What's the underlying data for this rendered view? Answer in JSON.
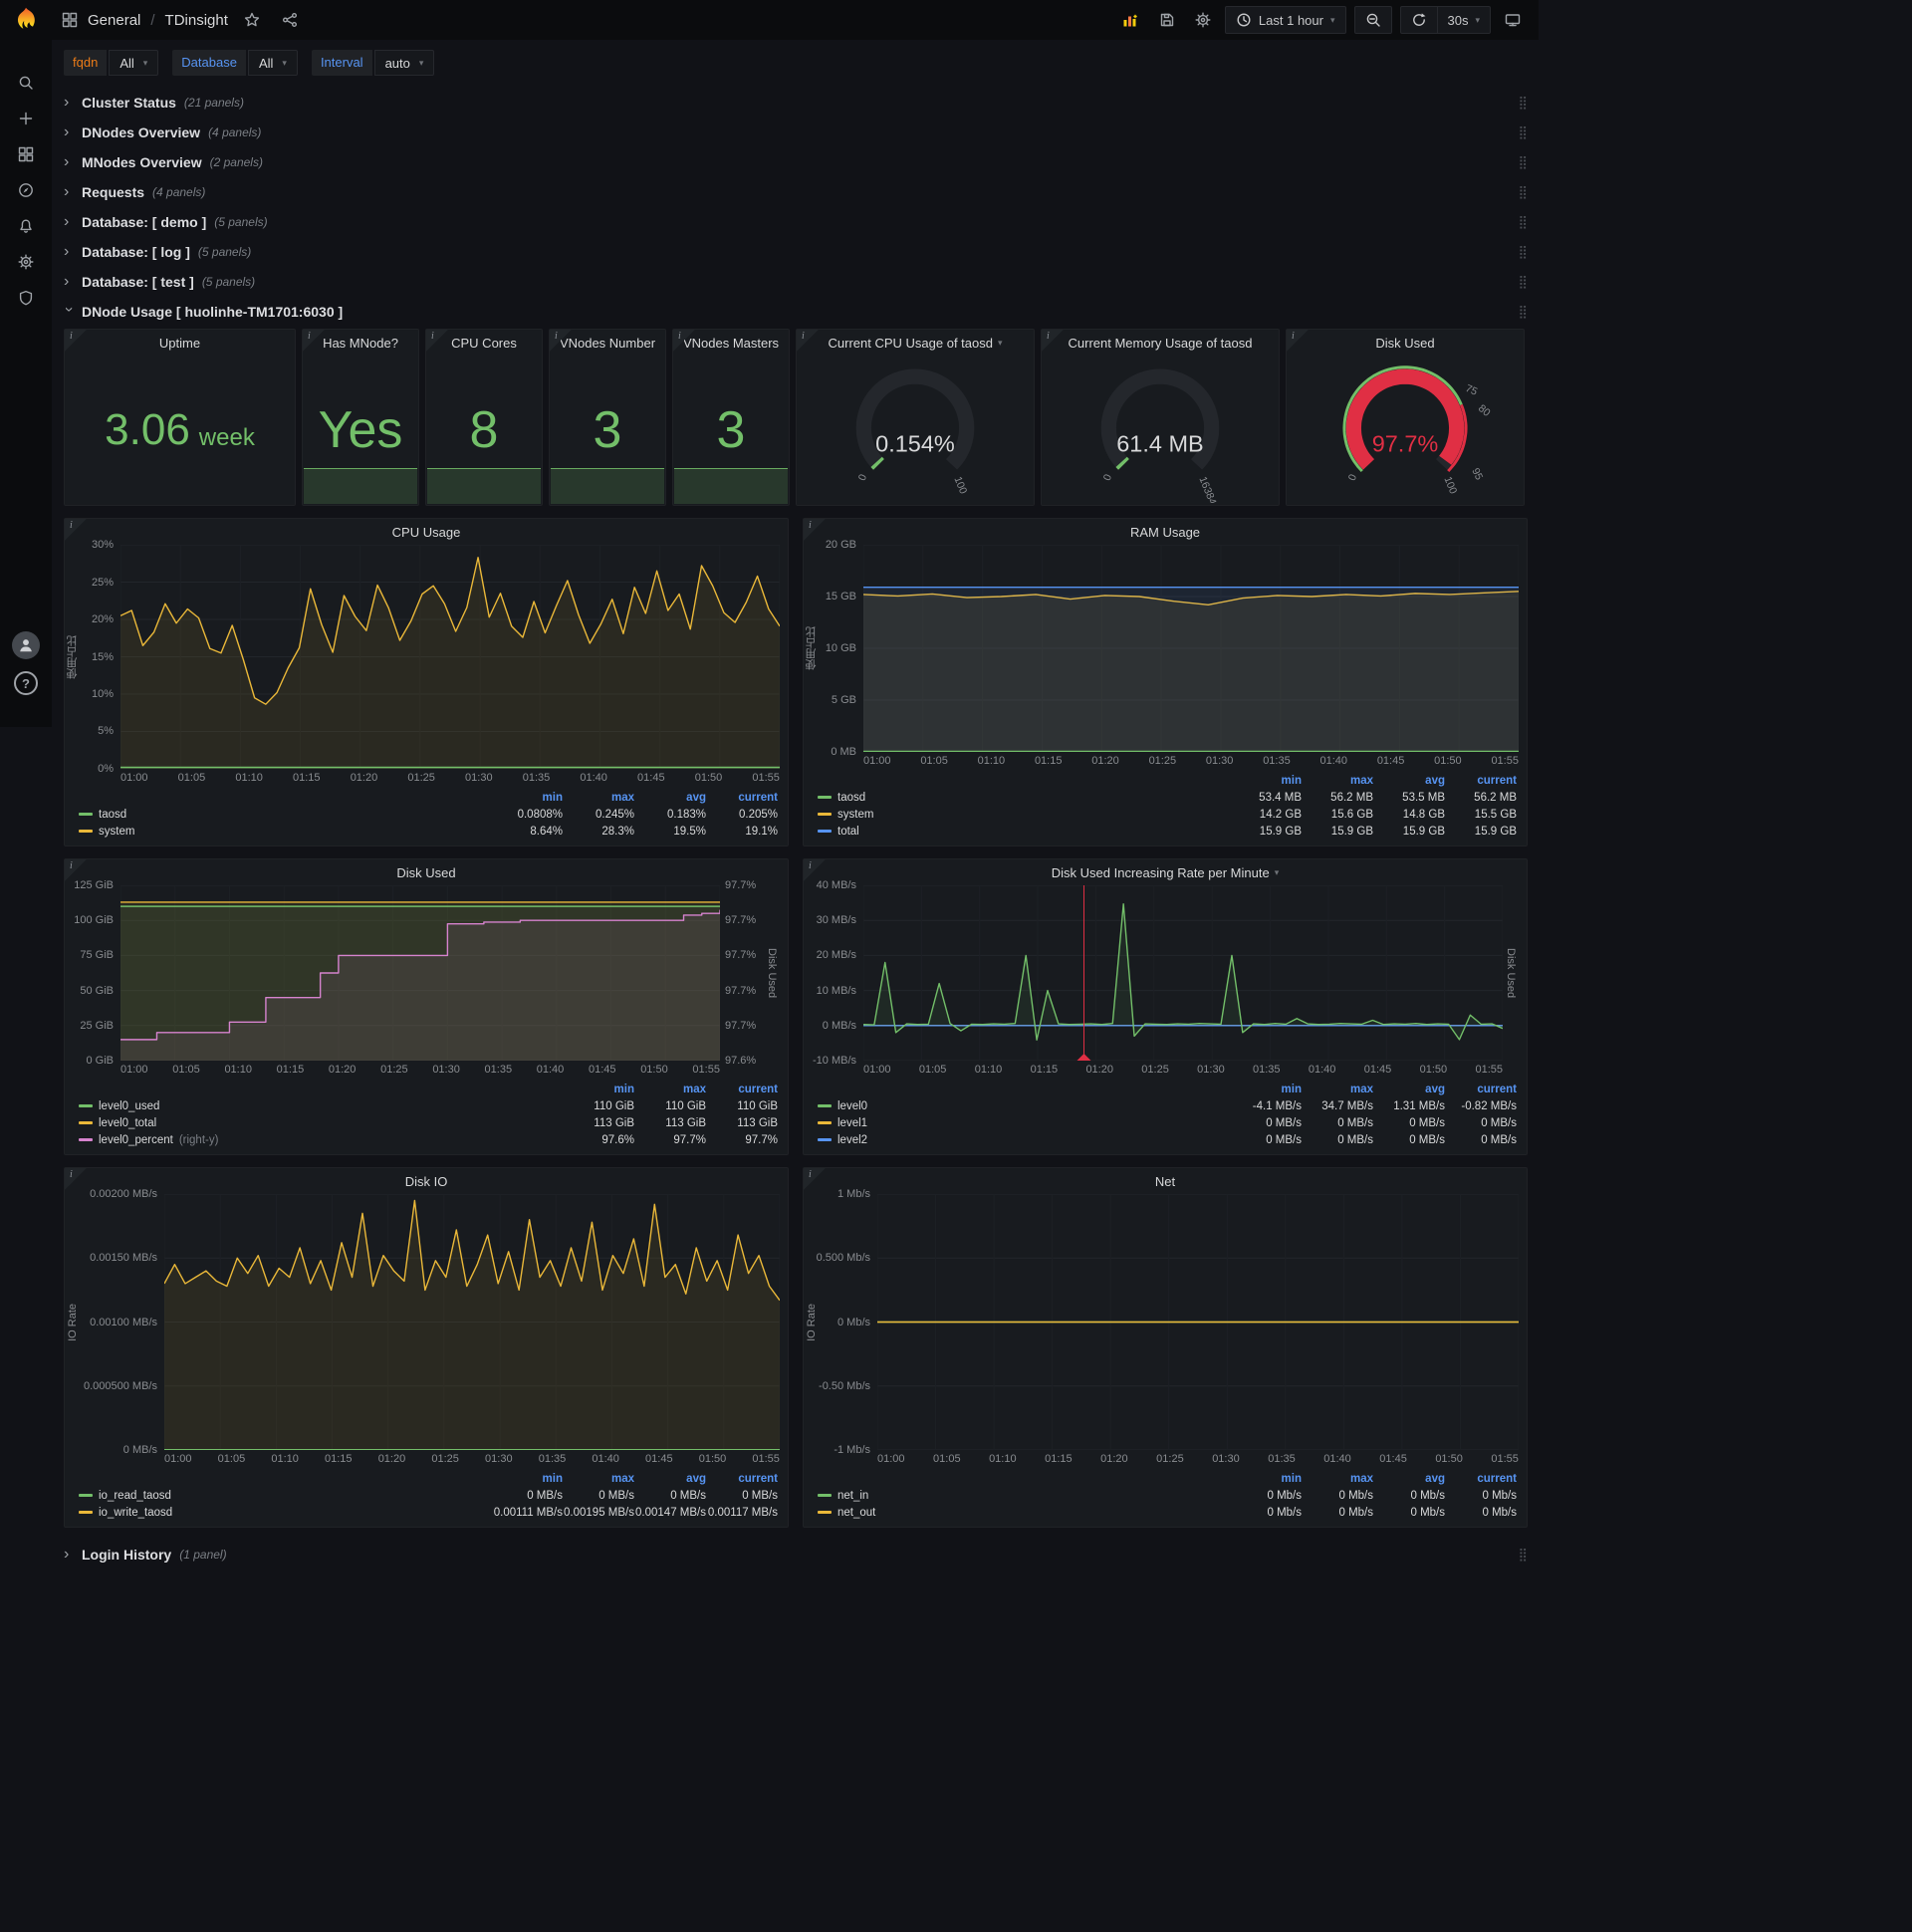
{
  "nav": {
    "breadcrumb": {
      "section": "General",
      "divider": "/",
      "page": "TDinsight"
    },
    "time_range": "Last 1 hour",
    "refresh_interval": "30s"
  },
  "filters": [
    {
      "label": "fqdn",
      "value": "All",
      "label_color": "#eb7b18"
    },
    {
      "label": "Database",
      "value": "All",
      "label_color": "#5794f2"
    },
    {
      "label": "Interval",
      "value": "auto",
      "label_color": "#5794f2"
    }
  ],
  "collapsed_rows": [
    {
      "title": "Cluster Status",
      "count": "(21 panels)"
    },
    {
      "title": "DNodes Overview",
      "count": "(4 panels)"
    },
    {
      "title": "MNodes Overview",
      "count": "(2 panels)"
    },
    {
      "title": "Requests",
      "count": "(4 panels)"
    },
    {
      "title": "Database: [ demo ]",
      "count": "(5 panels)"
    },
    {
      "title": "Database: [ log ]",
      "count": "(5 panels)"
    },
    {
      "title": "Database: [ test ]",
      "count": "(5 panels)"
    }
  ],
  "expanded_row": {
    "title": "DNode Usage [ huolinhe-TM1701:6030 ]"
  },
  "bottom_rows": [
    {
      "title": "Login History",
      "count": "(1 panel)"
    }
  ],
  "stats": [
    {
      "title": "Uptime",
      "value": "3.06",
      "unit": "week",
      "sparkline": false
    },
    {
      "title": "Has MNode?",
      "value": "Yes",
      "sparkline": true
    },
    {
      "title": "CPU Cores",
      "value": "8",
      "sparkline": true
    },
    {
      "title": "VNodes Number",
      "value": "3",
      "sparkline": true
    },
    {
      "title": "VNodes Masters",
      "value": "3",
      "sparkline": true
    }
  ],
  "gauges": [
    {
      "title": "Current CPU Usage of taosd",
      "has_menu": true,
      "value": "0.154%",
      "fraction": 0.00154,
      "min_label": "0",
      "max_label": "100",
      "arc_color": "#73bf69",
      "value_color": "#d8d9da",
      "ring": false
    },
    {
      "title": "Current Memory Usage of taosd",
      "has_menu": false,
      "value": "61.4 MB",
      "fraction": 0.00375,
      "min_label": "0",
      "max_label": "16384",
      "arc_color": "#73bf69",
      "value_color": "#d8d9da",
      "ring": false
    },
    {
      "title": "Disk Used",
      "has_menu": false,
      "value": "97.7%",
      "fraction": 0.977,
      "min_label": "0",
      "max_label": "100",
      "threshold_labels": [
        "75",
        "80",
        "95"
      ],
      "arc_color": "#e02f44",
      "value_color": "#e02f44",
      "ring": true
    }
  ],
  "x_ticks": [
    "01:00",
    "01:05",
    "01:10",
    "01:15",
    "01:20",
    "01:25",
    "01:30",
    "01:35",
    "01:40",
    "01:45",
    "01:50",
    "01:55"
  ],
  "chart_data": [
    {
      "id": "cpu",
      "type": "line",
      "title": "CPU Usage",
      "has_menu": false,
      "y_label": "使用占比",
      "ylim": [
        0,
        30
      ],
      "ytick_w": 40,
      "y_ticks": [
        "30%",
        "25%",
        "20%",
        "15%",
        "10%",
        "5%",
        "0%"
      ],
      "right": null,
      "annotation_x": null,
      "series": [
        {
          "name": "system",
          "color": "#eab839",
          "fill": true,
          "values": [
            20.5,
            21.2,
            16.5,
            18.3,
            22.1,
            19.5,
            21.4,
            20.2,
            16.1,
            15.5,
            19.2,
            14.6,
            9.5,
            8.64,
            10.2,
            13.5,
            16.2,
            24.1,
            19.3,
            15.6,
            23.2,
            20.4,
            18.5,
            24.6,
            21.5,
            17.2,
            19.8,
            23.4,
            24.5,
            22.1,
            18.4,
            21.6,
            28.3,
            20.3,
            23.5,
            19.1,
            17.6,
            22.4,
            18.2,
            21.8,
            25.2,
            20.6,
            16.8,
            19.4,
            22.7,
            18.1,
            24.3,
            20.8,
            26.5,
            21.2,
            23.4,
            18.7,
            27.2,
            24.5,
            20.9,
            19.6,
            22.3,
            25.8,
            21.4,
            19.1
          ]
        },
        {
          "name": "taosd",
          "color": "#73bf69",
          "fill": true,
          "values": [
            0.2,
            0.2
          ]
        }
      ],
      "legend": {
        "headers": [
          "min",
          "max",
          "avg",
          "current"
        ],
        "rows": [
          {
            "name": "taosd",
            "color": "#73bf69",
            "values": [
              "0.0808%",
              "0.245%",
              "0.183%",
              "0.205%"
            ]
          },
          {
            "name": "system",
            "color": "#eab839",
            "values": [
              "8.64%",
              "28.3%",
              "19.5%",
              "19.1%"
            ]
          }
        ]
      }
    },
    {
      "id": "ram",
      "type": "line",
      "title": "RAM Usage",
      "has_menu": false,
      "y_label": "使用占比",
      "ylim": [
        0,
        20
      ],
      "ytick_w": 44,
      "y_ticks": [
        "20 GB",
        "15 GB",
        "10 GB",
        "5 GB",
        "0 MB"
      ],
      "right": null,
      "annotation_x": null,
      "series": [
        {
          "name": "system",
          "color": "#eab839",
          "fill": true,
          "values": [
            15.2,
            15.05,
            15.25,
            14.9,
            15.0,
            15.2,
            14.75,
            15.1,
            15.0,
            14.55,
            14.2,
            14.85,
            15.1,
            15.0,
            15.2,
            15.05,
            15.3,
            15.2,
            15.35,
            15.5
          ]
        },
        {
          "name": "total",
          "color": "#5794f2",
          "fill": true,
          "values": [
            15.9,
            15.9
          ]
        },
        {
          "name": "taosd",
          "color": "#73bf69",
          "fill": true,
          "values": [
            0.055,
            0.055
          ]
        }
      ],
      "legend": {
        "headers": [
          "min",
          "max",
          "avg",
          "current"
        ],
        "rows": [
          {
            "name": "taosd",
            "color": "#73bf69",
            "values": [
              "53.4 MB",
              "56.2 MB",
              "53.5 MB",
              "56.2 MB"
            ]
          },
          {
            "name": "system",
            "color": "#eab839",
            "values": [
              "14.2 GB",
              "15.6 GB",
              "14.8 GB",
              "15.5 GB"
            ]
          },
          {
            "name": "total",
            "color": "#5794f2",
            "values": [
              "15.9 GB",
              "15.9 GB",
              "15.9 GB",
              "15.9 GB"
            ]
          }
        ]
      }
    },
    {
      "id": "disk",
      "type": "line",
      "title": "Disk Used",
      "has_menu": false,
      "y_label": "",
      "ylim": [
        0,
        125
      ],
      "ytick_w": 52,
      "y_ticks": [
        "125 GiB",
        "100 GiB",
        "75 GiB",
        "50 GiB",
        "25 GiB",
        "0 GiB"
      ],
      "right": {
        "label": "Disk Used",
        "ylim": [
          97.64,
          97.74
        ],
        "tick_w": 44,
        "ticks": [
          "97.7%",
          "97.7%",
          "97.7%",
          "97.7%",
          "97.7%",
          "97.6%"
        ]
      },
      "annotation_x": null,
      "series": [
        {
          "name": "level0_total",
          "color": "#eab839",
          "fill": true,
          "values": [
            113,
            113
          ]
        },
        {
          "name": "level0_used",
          "color": "#73bf69",
          "fill": true,
          "values": [
            110,
            110
          ]
        },
        {
          "name": "level0_percent",
          "color": "#d683ce",
          "fill": true,
          "axis": "right",
          "step": true,
          "values": [
            97.652,
            97.652,
            97.656,
            97.656,
            97.656,
            97.656,
            97.662,
            97.662,
            97.676,
            97.676,
            97.676,
            97.69,
            97.7,
            97.7,
            97.7,
            97.7,
            97.7,
            97.7,
            97.718,
            97.718,
            97.719,
            97.719,
            97.72,
            97.72,
            97.72,
            97.72,
            97.72,
            97.72,
            97.72,
            97.72,
            97.72,
            97.723,
            97.724,
            97.726
          ]
        }
      ],
      "legend": {
        "headers": [
          "min",
          "max",
          "current"
        ],
        "rows": [
          {
            "name": "level0_used",
            "color": "#73bf69",
            "values": [
              "110 GiB",
              "110 GiB",
              "110 GiB"
            ]
          },
          {
            "name": "level0_total",
            "color": "#eab839",
            "values": [
              "113 GiB",
              "113 GiB",
              "113 GiB"
            ]
          },
          {
            "name": "level0_percent",
            "color": "#d683ce",
            "suffix": "(right-y)",
            "values": [
              "97.6%",
              "97.7%",
              "97.7%"
            ]
          }
        ]
      }
    },
    {
      "id": "rate",
      "type": "line",
      "title": "Disk Used Increasing Rate per Minute",
      "has_menu": true,
      "y_label": "",
      "ylim": [
        -10,
        40
      ],
      "ytick_w": 56,
      "y_ticks": [
        "40 MB/s",
        "30 MB/s",
        "20 MB/s",
        "10 MB/s",
        "0 MB/s",
        "-10 MB/s"
      ],
      "right": {
        "label": "Disk Used",
        "ylim": null,
        "tick_w": 0,
        "ticks": []
      },
      "annotation_x": 0.345,
      "series": [
        {
          "name": "level1",
          "color": "#eab839",
          "fill": false,
          "values": [
            0,
            0
          ]
        },
        {
          "name": "level2",
          "color": "#5794f2",
          "fill": false,
          "values": [
            0,
            0
          ]
        },
        {
          "name": "level0",
          "color": "#73bf69",
          "fill": true,
          "values": [
            0.3,
            0.2,
            18,
            -2,
            0.5,
            0.3,
            0.4,
            12,
            0.6,
            -1.5,
            0.4,
            0.3,
            0.5,
            0.4,
            0.6,
            20,
            -4.1,
            10,
            0.5,
            0.3,
            0.4,
            0.5,
            0.3,
            0.6,
            34.7,
            -3,
            0.5,
            0.4,
            0.3,
            0.5,
            0.4,
            0.6,
            0.5,
            0.4,
            20,
            -2,
            0.5,
            0.3,
            0.6,
            0.4,
            2,
            0.5,
            0.3,
            0.4,
            0.6,
            0.5,
            0.4,
            1.5,
            0.3,
            0.5,
            0.4,
            0.6,
            0.3,
            0.5,
            0.4,
            -4,
            3,
            0.4,
            0.5,
            -0.82
          ]
        }
      ],
      "legend": {
        "headers": [
          "min",
          "max",
          "avg",
          "current"
        ],
        "rows": [
          {
            "name": "level0",
            "color": "#73bf69",
            "values": [
              "-4.1 MB/s",
              "34.7 MB/s",
              "1.31 MB/s",
              "-0.82 MB/s"
            ]
          },
          {
            "name": "level1",
            "color": "#eab839",
            "values": [
              "0 MB/s",
              "0 MB/s",
              "0 MB/s",
              "0 MB/s"
            ]
          },
          {
            "name": "level2",
            "color": "#5794f2",
            "values": [
              "0 MB/s",
              "0 MB/s",
              "0 MB/s",
              "0 MB/s"
            ]
          }
        ]
      }
    },
    {
      "id": "io",
      "type": "line",
      "title": "Disk IO",
      "has_menu": false,
      "y_label": "IO Rate",
      "ylim": [
        0,
        0.002
      ],
      "ytick_w": 84,
      "y_ticks": [
        "0.00200 MB/s",
        "0.00150 MB/s",
        "0.00100 MB/s",
        "0.000500 MB/s",
        "0 MB/s"
      ],
      "right": null,
      "annotation_x": null,
      "series": [
        {
          "name": "io_write_taosd",
          "color": "#eab839",
          "fill": true,
          "values": [
            0.0013,
            0.00145,
            0.0013,
            0.00135,
            0.0014,
            0.00132,
            0.00128,
            0.0015,
            0.00138,
            0.00152,
            0.00128,
            0.00142,
            0.00135,
            0.00158,
            0.0013,
            0.00148,
            0.00125,
            0.00162,
            0.00135,
            0.00185,
            0.00128,
            0.00152,
            0.0014,
            0.00132,
            0.00195,
            0.00125,
            0.00148,
            0.00135,
            0.00172,
            0.00128,
            0.00145,
            0.00168,
            0.0013,
            0.00155,
            0.00125,
            0.0018,
            0.00135,
            0.00148,
            0.00128,
            0.00158,
            0.00132,
            0.00178,
            0.00125,
            0.00152,
            0.00138,
            0.00165,
            0.00128,
            0.00192,
            0.00135,
            0.00145,
            0.00122,
            0.00158,
            0.00132,
            0.00148,
            0.00125,
            0.00168,
            0.00138,
            0.00152,
            0.00128,
            0.00117
          ]
        },
        {
          "name": "io_read_taosd",
          "color": "#73bf69",
          "fill": false,
          "values": [
            2e-06,
            2e-06
          ]
        }
      ],
      "legend": {
        "headers": [
          "min",
          "max",
          "avg",
          "current"
        ],
        "rows": [
          {
            "name": "io_read_taosd",
            "color": "#73bf69",
            "values": [
              "0 MB/s",
              "0 MB/s",
              "0 MB/s",
              "0 MB/s"
            ]
          },
          {
            "name": "io_write_taosd",
            "color": "#eab839",
            "values": [
              "0.00111 MB/s",
              "0.00195 MB/s",
              "0.00147 MB/s",
              "0.00117 MB/s"
            ]
          }
        ]
      }
    },
    {
      "id": "net",
      "type": "line",
      "title": "Net",
      "has_menu": false,
      "y_label": "IO Rate",
      "ylim": [
        -1,
        1
      ],
      "ytick_w": 58,
      "y_ticks": [
        "1 Mb/s",
        "0.500 Mb/s",
        "0 Mb/s",
        "-0.50 Mb/s",
        "-1 Mb/s"
      ],
      "right": null,
      "annotation_x": null,
      "series": [
        {
          "name": "net_in",
          "color": "#73bf69",
          "fill": false,
          "values": [
            0,
            0
          ]
        },
        {
          "name": "net_out",
          "color": "#eab839",
          "fill": false,
          "values": [
            0,
            0
          ]
        }
      ],
      "legend": {
        "headers": [
          "min",
          "max",
          "avg",
          "current"
        ],
        "rows": [
          {
            "name": "net_in",
            "color": "#73bf69",
            "values": [
              "0 Mb/s",
              "0 Mb/s",
              "0 Mb/s",
              "0 Mb/s"
            ]
          },
          {
            "name": "net_out",
            "color": "#eab839",
            "values": [
              "0 Mb/s",
              "0 Mb/s",
              "0 Mb/s",
              "0 Mb/s"
            ]
          }
        ]
      }
    }
  ]
}
